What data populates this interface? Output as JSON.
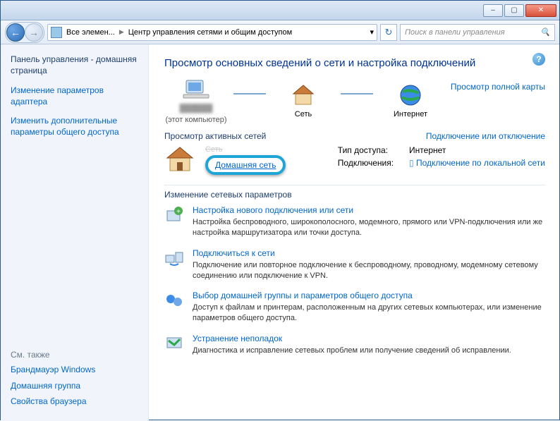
{
  "titlebar": {
    "min": "–",
    "max": "▢",
    "close": "✕"
  },
  "toolbar": {
    "back": "←",
    "fwd": "→",
    "crumb1": "Все элемен...",
    "crumb2": "Центр управления сетями и общим доступом",
    "dropdown": "▾",
    "refresh": "↻",
    "search_placeholder": "Поиск в панели управления",
    "search_icon": "🔍"
  },
  "sidebar": {
    "home": "Панель управления - домашняя страница",
    "links": [
      "Изменение параметров адаптера",
      "Изменить дополнительные параметры общего доступа"
    ],
    "see_also": "См. также",
    "see_links": [
      "Брандмауэр Windows",
      "Домашняя группа",
      "Свойства браузера"
    ]
  },
  "main": {
    "help": "?",
    "title": "Просмотр основных сведений о сети и настройка подключений",
    "map": {
      "computer_sub": "(этот компьютер)",
      "network": "Сеть",
      "internet": "Интернет",
      "full_map": "Просмотр полной карты"
    },
    "active_hd": "Просмотр активных сетей",
    "active_right": "Подключение или отключение",
    "net": {
      "name": "Сеть",
      "home_link": "Домашняя сеть",
      "type_lbl": "Тип доступа:",
      "type_val": "Интернет",
      "conn_lbl": "Подключения:",
      "conn_val": "Подключение по локальной сети"
    },
    "change_hd": "Изменение сетевых параметров",
    "opts": [
      {
        "title": "Настройка нового подключения или сети",
        "desc": "Настройка беспроводного, широкополосного, модемного, прямого или VPN-подключения или же настройка маршрутизатора или точки доступа."
      },
      {
        "title": "Подключиться к сети",
        "desc": "Подключение или повторное подключение к беспроводному, проводному, модемному сетевому соединению или подключение к VPN."
      },
      {
        "title": "Выбор домашней группы и параметров общего доступа",
        "desc": "Доступ к файлам и принтерам, расположенным на других сетевых компьютерах, или изменение параметров общего доступа."
      },
      {
        "title": "Устранение неполадок",
        "desc": "Диагностика и исправление сетевых проблем или получение сведений об исправлении."
      }
    ]
  }
}
